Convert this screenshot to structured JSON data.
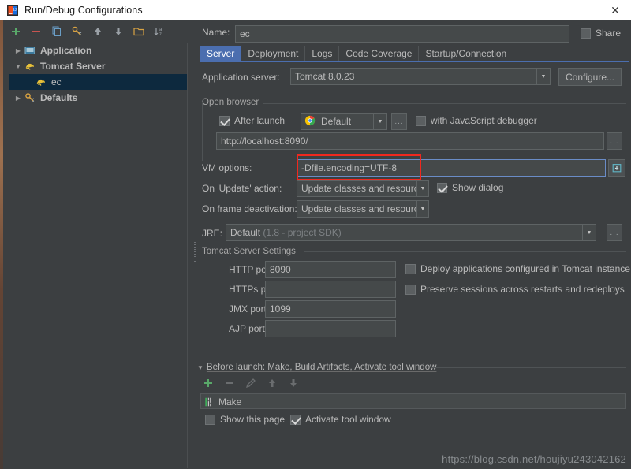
{
  "window": {
    "title": "Run/Debug Configurations",
    "close_label": "✕",
    "app_icon": "intellij-idea-icon"
  },
  "left_panel": {
    "toolbar": [
      {
        "name": "add-configuration-button",
        "icon": "plus-icon",
        "tooltip": "Add New Configuration"
      },
      {
        "name": "remove-configuration-button",
        "icon": "minus-icon",
        "tooltip": "Remove Configuration"
      },
      {
        "name": "copy-configuration-button",
        "icon": "copy-icon",
        "tooltip": "Copy Configuration"
      },
      {
        "name": "save-configuration-button",
        "icon": "save-configuration-icon",
        "tooltip": "Save Configuration"
      },
      {
        "name": "move-up-button",
        "icon": "arrow-up-icon",
        "tooltip": "Move Up"
      },
      {
        "name": "move-down-button",
        "icon": "arrow-down-icon",
        "tooltip": "Move Down"
      },
      {
        "name": "create-folder-button",
        "icon": "folder-icon",
        "tooltip": "Create New Folder"
      },
      {
        "name": "sort-configurations-button",
        "icon": "sort-alphabetically-icon",
        "tooltip": "Sort Configurations"
      }
    ],
    "tree": [
      {
        "label": "Application",
        "icon": "application-icon",
        "expanded": false,
        "selected": false,
        "level": 0
      },
      {
        "label": "Tomcat Server",
        "icon": "tomcat-icon",
        "expanded": true,
        "selected": false,
        "level": 0
      },
      {
        "label": "ec",
        "icon": "tomcat-icon",
        "expanded": null,
        "selected": true,
        "level": 1
      },
      {
        "label": "Defaults",
        "icon": "defaults-icon",
        "expanded": false,
        "selected": false,
        "level": 0
      }
    ]
  },
  "name_row": {
    "label": "Name:",
    "value": "ec",
    "share_label": "Share",
    "share_checked": false
  },
  "tabs": [
    {
      "label": "Server",
      "active": true
    },
    {
      "label": "Deployment",
      "active": false
    },
    {
      "label": "Logs",
      "active": false
    },
    {
      "label": "Code Coverage",
      "active": false
    },
    {
      "label": "Startup/Connection",
      "active": false
    }
  ],
  "server_tab": {
    "application_server": {
      "label": "Application server:",
      "value": "Tomcat 8.0.23",
      "configure_button": "Configure..."
    },
    "open_browser": {
      "title": "Open browser",
      "after_launch_label": "After launch",
      "after_launch_checked": true,
      "browser_value": "Default",
      "browser_icon": "chrome-icon",
      "browse_button": "...",
      "js_debugger_label": "with JavaScript debugger",
      "js_debugger_checked": false,
      "url_value": "http://localhost:8090/",
      "url_browse_button": "..."
    },
    "vm_options": {
      "label": "VM options:",
      "value": "-Dfile.encoding=UTF-8",
      "expand_icon": "expand-editor-icon",
      "highlight_color": "#f0281e",
      "focused": true
    },
    "on_update_action": {
      "label": "On 'Update' action:",
      "value": "Update classes and resources",
      "show_dialog_label": "Show dialog",
      "show_dialog_checked": true
    },
    "on_frame_deactivation": {
      "label": "On frame deactivation:",
      "value": "Update classes and resources"
    },
    "jre": {
      "label": "JRE:",
      "value": "Default",
      "value_hint": "(1.8 - project SDK)",
      "browse_button": "..."
    },
    "tomcat_settings": {
      "title": "Tomcat Server Settings",
      "fields": [
        {
          "label": "HTTP port:",
          "value": "8090"
        },
        {
          "label": "HTTPs port:",
          "value": ""
        },
        {
          "label": "JMX port:",
          "value": "1099"
        },
        {
          "label": "AJP port:",
          "value": ""
        }
      ],
      "checkboxes": [
        {
          "label": "Deploy applications configured in Tomcat instance",
          "checked": false
        },
        {
          "label": "Preserve sessions across restarts and redeploys",
          "checked": false
        }
      ]
    }
  },
  "before_launch": {
    "title": "Before launch: Make, Build Artifacts, Activate tool window",
    "toolbar": [
      {
        "name": "add-task-button",
        "icon": "plus-icon"
      },
      {
        "name": "remove-task-button",
        "icon": "minus-icon"
      },
      {
        "name": "edit-task-button",
        "icon": "pencil-icon"
      },
      {
        "name": "move-task-up-button",
        "icon": "arrow-up-icon"
      },
      {
        "name": "move-task-down-button",
        "icon": "arrow-down-icon"
      }
    ],
    "tasks": [
      {
        "label": "Make",
        "icon": "make-icon"
      }
    ],
    "show_this_page_label": "Show this page",
    "show_this_page_checked": false,
    "activate_tool_window_label": "Activate tool window",
    "activate_tool_window_checked": true
  },
  "watermark": {
    "text": "https://blog.csdn.net/houjiyu243042162"
  },
  "colors": {
    "background": "#3c3f41",
    "field": "#45494a",
    "selection": "#0d293e",
    "tab_active": "#4b6eaf",
    "accent_red": "#f0281e",
    "focus_blue": "#6a8cc7"
  }
}
